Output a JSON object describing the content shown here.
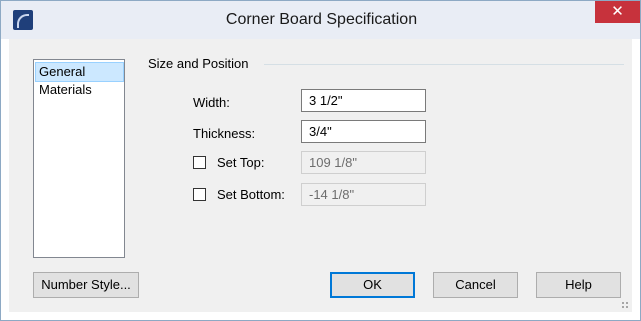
{
  "window": {
    "title": "Corner Board Specification",
    "close_glyph": "✕",
    "icon": "app-logo-icon"
  },
  "sidebar": {
    "items": [
      {
        "label": "General",
        "selected": true
      },
      {
        "label": "Materials",
        "selected": false
      }
    ]
  },
  "group": {
    "label": "Size and Position",
    "fields": {
      "width": {
        "label": "Width:",
        "value": "3 1/2\""
      },
      "thickness": {
        "label": "Thickness:",
        "value": "3/4\""
      },
      "set_top": {
        "label": "Set Top:",
        "checked": false,
        "value": "109 1/8\""
      },
      "set_bottom": {
        "label": "Set Bottom:",
        "checked": false,
        "value": "-14 1/8\""
      }
    }
  },
  "buttons": {
    "number_style": "Number Style...",
    "ok": "OK",
    "cancel": "Cancel",
    "help": "Help"
  },
  "colors": {
    "close_button": "#c7323c",
    "selection": "#cce8ff",
    "default_button_border": "#0078d7"
  }
}
